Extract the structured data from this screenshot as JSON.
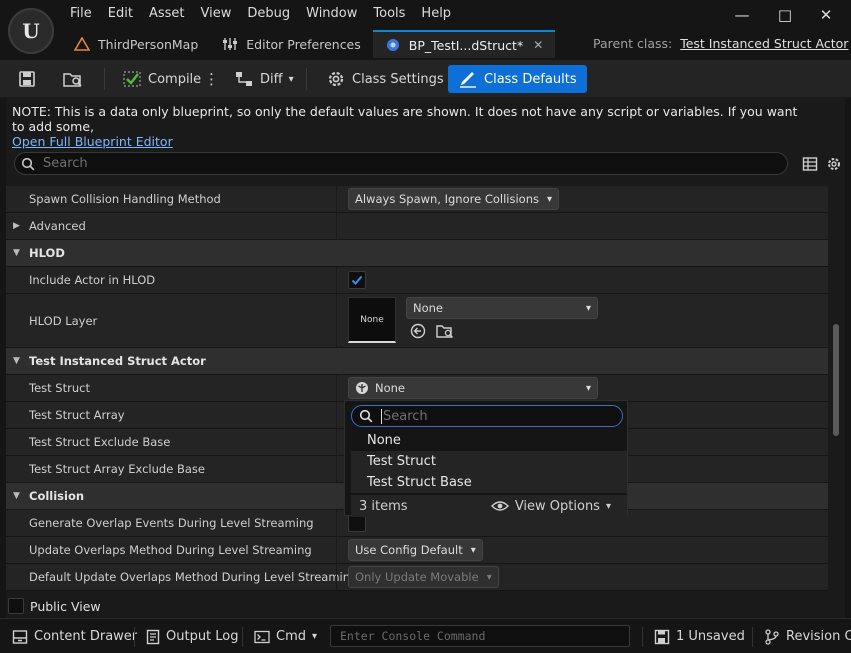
{
  "menu": [
    "File",
    "Edit",
    "Asset",
    "View",
    "Debug",
    "Window",
    "Tools",
    "Help"
  ],
  "window_controls": {
    "minimize": "—",
    "maximize": "□",
    "close": "✕"
  },
  "tabs": [
    {
      "label": "ThirdPersonMap",
      "icon": "level-icon"
    },
    {
      "label": "Editor Preferences",
      "icon": "sliders-icon"
    },
    {
      "label": "BP_TestI...dStruct*",
      "icon": "blueprint-icon",
      "active": true
    }
  ],
  "parent_class": {
    "label": "Parent class:",
    "value": "Test Instanced Struct Actor"
  },
  "toolbar": {
    "compile_label": "Compile",
    "diff_label": "Diff",
    "class_settings_label": "Class Settings",
    "class_defaults_label": "Class Defaults"
  },
  "note": {
    "text": "NOTE: This is a data only blueprint, so only the default values are shown.  It does not have any script or variables.  If you want to add some,",
    "link": "Open Full Blueprint Editor"
  },
  "details_search_placeholder": "Search",
  "rows": {
    "spawn_collision": {
      "label": "Spawn Collision Handling Method",
      "value": "Always Spawn, Ignore Collisions"
    },
    "advanced": {
      "label": "Advanced"
    },
    "hlod": {
      "label": "HLOD"
    },
    "include_actor_hlod": {
      "label": "Include Actor in HLOD",
      "checked": true
    },
    "hlod_layer": {
      "label": "HLOD Layer",
      "thumb": "None",
      "value": "None"
    },
    "test_instanced": {
      "label": "Test Instanced Struct Actor"
    },
    "test_struct": {
      "label": "Test Struct",
      "value": "None"
    },
    "test_struct_array": {
      "label": "Test Struct Array"
    },
    "test_struct_exclude": {
      "label": "Test Struct Exclude Base"
    },
    "test_struct_array_exclude": {
      "label": "Test Struct Array Exclude Base"
    },
    "collision": {
      "label": "Collision"
    },
    "gen_overlap": {
      "label": "Generate Overlap Events During Level Streaming",
      "checked": false
    },
    "update_overlaps": {
      "label": "Update Overlaps Method During Level Streaming",
      "value": "Use Config Default"
    },
    "default_update_overlaps": {
      "label": "Default Update Overlaps Method During Level Streaming",
      "value": "Only Update Movable"
    }
  },
  "popup": {
    "search_placeholder": "Search",
    "items": [
      "None",
      "Test Struct",
      "Test Struct Base"
    ],
    "count": "3 items",
    "view_options": "View Options"
  },
  "public_view": {
    "label": "Public View",
    "checked": false
  },
  "statusbar": {
    "content_drawer": "Content Drawer",
    "output_log": "Output Log",
    "cmd": "Cmd",
    "console_placeholder": "Enter Console Command",
    "unsaved": "1 Unsaved",
    "revision": "Revision Co"
  },
  "colors": {
    "accent": "#0e6fd6",
    "check": "#3b8eea",
    "link": "#7fb5ff"
  }
}
